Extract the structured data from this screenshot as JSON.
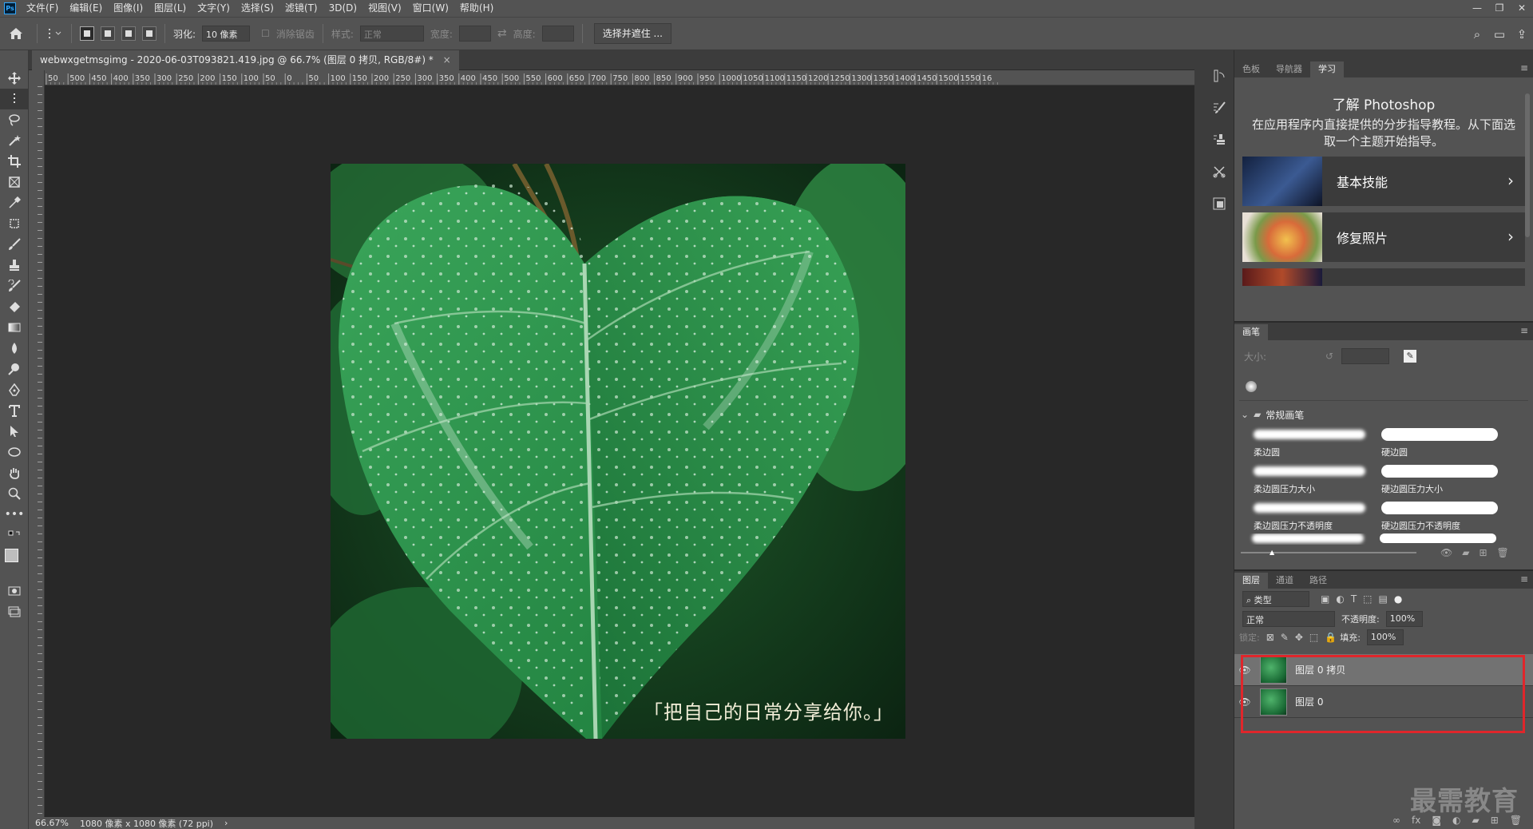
{
  "menubar": {
    "logo": "Ps",
    "items": [
      "文件(F)",
      "编辑(E)",
      "图像(I)",
      "图层(L)",
      "文字(Y)",
      "选择(S)",
      "滤镜(T)",
      "3D(D)",
      "视图(V)",
      "窗口(W)",
      "帮助(H)"
    ],
    "win_min": "—",
    "win_restore": "❐",
    "win_close": "✕"
  },
  "options": {
    "feather_label": "羽化:",
    "feather_value": "10 像素",
    "antialias_label": "消除锯齿",
    "style_label": "样式:",
    "style_value": "正常",
    "width_label": "宽度:",
    "height_label": "高度:",
    "select_mask_button": "选择并遮住 ..."
  },
  "document": {
    "tab_title": "webwxgetmsgimg - 2020-06-03T093821.419.jpg @ 66.7% (图层 0 拷贝, RGB/8#) *",
    "tab_close": "×",
    "caption": "「把自己的日常分享给你。」",
    "ruler_h_labels": [
      "50",
      "500",
      "450",
      "400",
      "350",
      "300",
      "250",
      "200",
      "150",
      "100",
      "50",
      "0",
      "50",
      "100",
      "150",
      "200",
      "250",
      "300",
      "350",
      "400",
      "450",
      "500",
      "550",
      "600",
      "650",
      "700",
      "750",
      "800",
      "850",
      "900",
      "950",
      "1000",
      "1050",
      "1100",
      "1150",
      "1200",
      "1250",
      "1300",
      "1350",
      "1400",
      "1450",
      "1500",
      "1550",
      "16"
    ]
  },
  "status": {
    "zoom": "66.67%",
    "doc_size": "1080 像素 x 1080 像素 (72 ppi)",
    "arrow": "›"
  },
  "learn_panel": {
    "tabs": [
      "色板",
      "导航器",
      "学习"
    ],
    "active_tab": "学习",
    "title": "了解 Photoshop",
    "desc": "在应用程序内直接提供的分步指导教程。从下面选取一个主题开始指导。",
    "cards": [
      {
        "title": "基本技能"
      },
      {
        "title": "修复照片"
      }
    ]
  },
  "brush_panel": {
    "tab": "画笔",
    "size_label": "大小:",
    "folder": "常规画笔",
    "brushes": [
      "柔边圆",
      "硬边圆",
      "柔边圆压力大小",
      "硬边圆压力大小",
      "柔边圆压力不透明度",
      "硬边圆压力不透明度"
    ]
  },
  "layers_panel": {
    "tabs": [
      "图层",
      "通道",
      "路径"
    ],
    "filter_label": "类型",
    "blend_mode": "正常",
    "opacity_label": "不透明度:",
    "opacity_value": "100%",
    "lock_label": "锁定:",
    "fill_label": "填充:",
    "fill_value": "100%",
    "layers": [
      {
        "name": "图层 0 拷贝",
        "selected": true
      },
      {
        "name": "图层 0",
        "selected": false
      }
    ]
  },
  "watermark": "最需教育",
  "colors": {
    "accent_highlight": "#e0262b",
    "panel_bg": "#535353",
    "canvas_bg": "#282828"
  }
}
